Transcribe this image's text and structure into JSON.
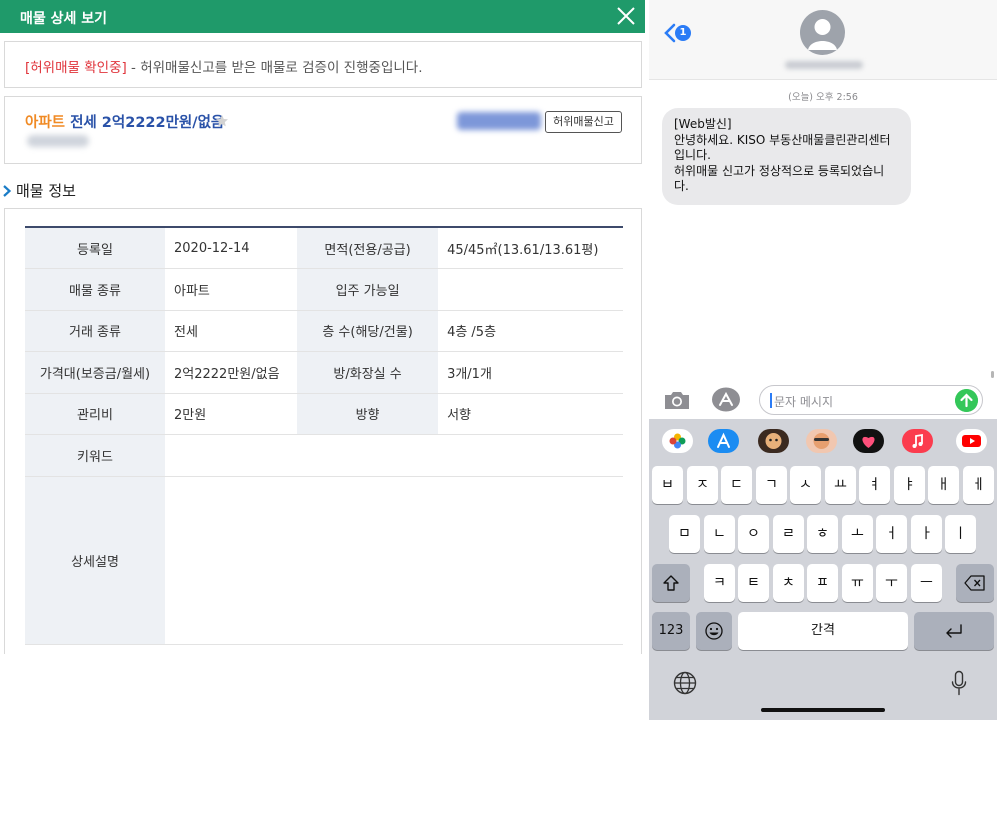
{
  "listing": {
    "window_title": "매물 상세 보기",
    "notice": {
      "tag": "[허위매물 확인중]",
      "text": " - 허위매물신고를 받은 매물로 검증이 진행중입니다."
    },
    "headline": {
      "type": "아파트",
      "deal": " 전세 2억2222만원/없음"
    },
    "report_button": "허위매물신고",
    "section_title": "매물 정보",
    "table": {
      "reg_date_label": "등록일",
      "reg_date": "2020-12-14",
      "area_label": "면적(전용/공급)",
      "area": "45/45㎡(13.61/13.61평)",
      "kind_label": "매물 종류",
      "kind": "아파트",
      "movein_label": "입주 가능일",
      "movein": "",
      "trade_label": "거래 종류",
      "trade": "전세",
      "floor_label": "층 수(해당/건물)",
      "floor": "4층 /5층",
      "price_label": "가격대(보증금/월세)",
      "price": "2억2222만원/없음",
      "rooms_label": "방/화장실 수",
      "rooms": "3개/1개",
      "fee_label": "관리비",
      "fee": "2만원",
      "direction_label": "방향",
      "direction": "서향",
      "keyword_label": "키워드",
      "keyword": "",
      "desc_label": "상세설명",
      "desc": ""
    }
  },
  "messages": {
    "back_badge": "1",
    "timestamp": "(오늘) 오후 2:56",
    "bubble_lines": [
      "[Web발신]",
      "안녕하세요. KISO 부동산매물클린관리센터",
      "입니다.",
      "허위매물 신고가 정상적으로 등록되었습니",
      "다."
    ],
    "input_placeholder": "문자 메시지",
    "keyboard": {
      "row1": [
        "ㅂ",
        "ㅈ",
        "ㄷ",
        "ㄱ",
        "ㅅ",
        "ㅛ",
        "ㅕ",
        "ㅑ",
        "ㅐ",
        "ㅔ"
      ],
      "row2": [
        "ㅁ",
        "ㄴ",
        "ㅇ",
        "ㄹ",
        "ㅎ",
        "ㅗ",
        "ㅓ",
        "ㅏ",
        "ㅣ"
      ],
      "row3": [
        "ㅋ",
        "ㅌ",
        "ㅊ",
        "ㅍ",
        "ㅠ",
        "ㅜ",
        "ㅡ"
      ],
      "numbers_key": "123",
      "space_key": "간격"
    }
  },
  "colors": {
    "title_green": "#1f9a6a",
    "notice_red": "#e0353c",
    "headline_orange": "#f08a24",
    "headline_blue": "#2a52a8",
    "ios_blue": "#2b7cf6",
    "send_green": "#34c759"
  },
  "icons": {
    "close": "close-icon",
    "star": "star-icon",
    "chevron": "chevron-right-icon",
    "back": "back-chevron-icon",
    "camera": "camera-icon",
    "appstore": "appstore-icon",
    "send": "send-arrow-icon",
    "shift": "shift-icon",
    "delete": "delete-icon",
    "emoji": "emoji-icon",
    "return": "return-icon",
    "globe": "globe-icon",
    "mic": "microphone-icon"
  }
}
